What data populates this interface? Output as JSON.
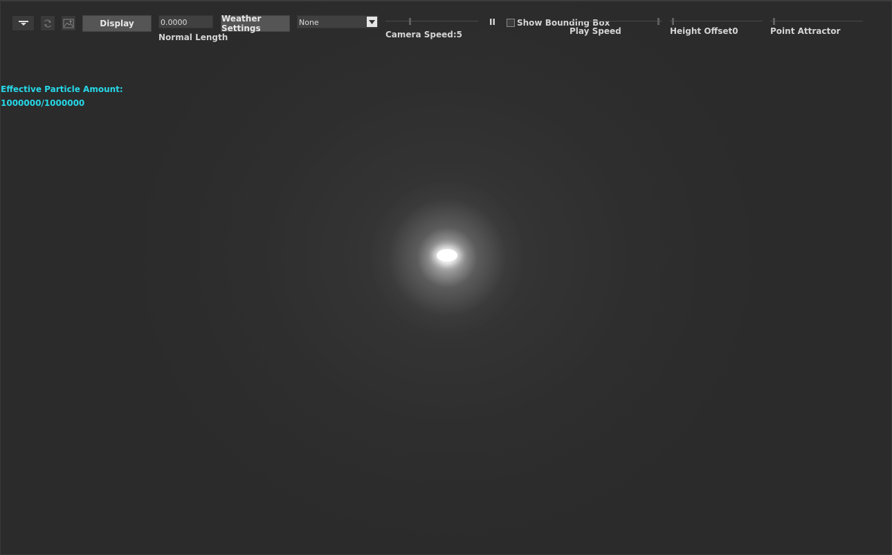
{
  "toolbar": {
    "display_label": "Display",
    "normal_length_value": "0.0000",
    "normal_length_label": "Normal Length",
    "weather_settings_label": "Weather Settings",
    "dropdown_selected": "None",
    "camera_speed_label": "Camera Speed:5",
    "pause_glyph": "II",
    "show_bounding_box_label": "Show Bounding Box",
    "play_speed_label": "Play Speed",
    "height_offset_label": "Height Offset0",
    "point_attractor_label": "Point Attractor"
  },
  "info": {
    "effective_label": "Effective Particle Amount:",
    "effective_value": "1000000/1000000"
  },
  "colors": {
    "background": "#2b2b2b",
    "info_text": "#26d8e8"
  }
}
